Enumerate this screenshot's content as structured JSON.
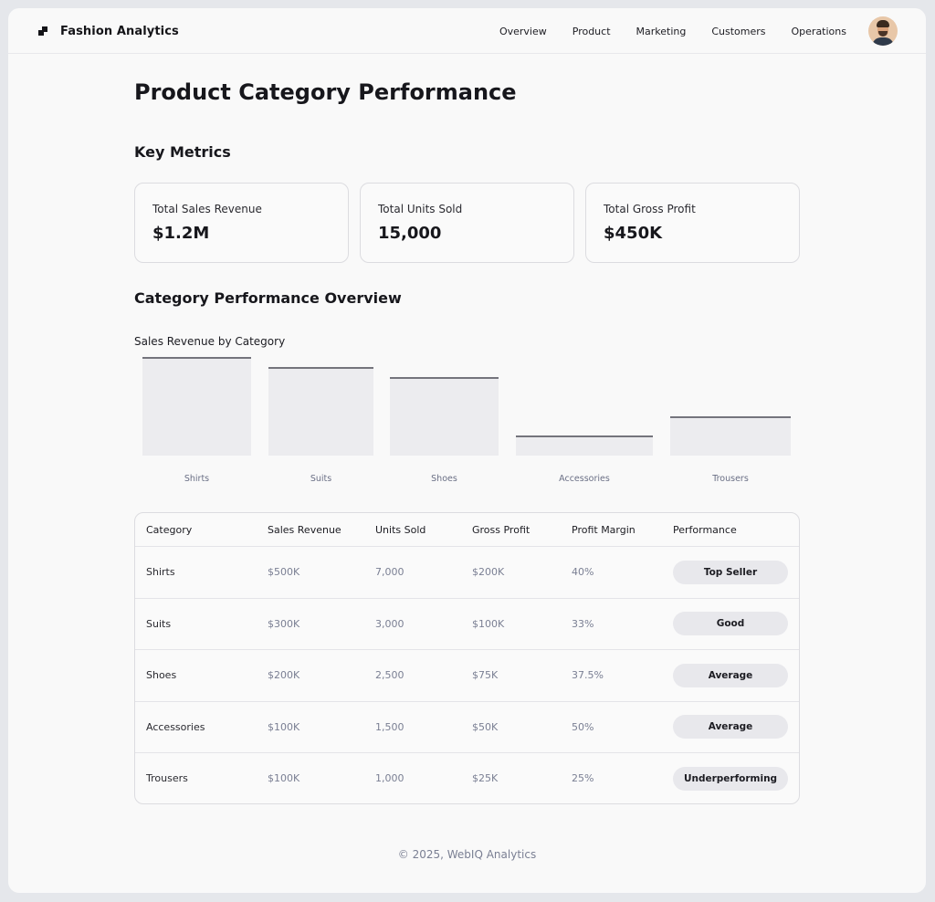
{
  "app": {
    "title": "Fashion Analytics"
  },
  "nav": [
    "Overview",
    "Product",
    "Marketing",
    "Customers",
    "Operations"
  ],
  "page_title": "Product Category Performance",
  "sections": {
    "key_metrics": "Key Metrics",
    "category_overview": "Category Performance Overview"
  },
  "metrics": [
    {
      "label": "Total Sales Revenue",
      "value": "$1.2M"
    },
    {
      "label": "Total Units Sold",
      "value": "15,000"
    },
    {
      "label": "Total Gross Profit",
      "value": "$450K"
    }
  ],
  "chart_data": {
    "type": "bar",
    "title": "Sales Revenue by Category",
    "categories": [
      "Shirts",
      "Suits",
      "Shoes",
      "Accessories",
      "Trousers"
    ],
    "values": [
      500,
      450,
      400,
      100,
      200
    ],
    "ylim": [
      0,
      500
    ],
    "grid": false
  },
  "table": {
    "headers": [
      "Category",
      "Sales Revenue",
      "Units Sold",
      "Gross Profit",
      "Profit Margin",
      "Performance"
    ],
    "rows": [
      [
        "Shirts",
        "$500K",
        "7,000",
        "$200K",
        "40%",
        "Top Seller"
      ],
      [
        "Suits",
        "$300K",
        "3,000",
        "$100K",
        "33%",
        "Good"
      ],
      [
        "Shoes",
        "$200K",
        "2,500",
        "$75K",
        "37.5%",
        "Average"
      ],
      [
        "Accessories",
        "$100K",
        "1,500",
        "$50K",
        "50%",
        "Average"
      ],
      [
        "Trousers",
        "$100K",
        "1,000",
        "$25K",
        "25%",
        "Underperforming"
      ]
    ]
  },
  "footer": "© 2025, WebIQ Analytics"
}
